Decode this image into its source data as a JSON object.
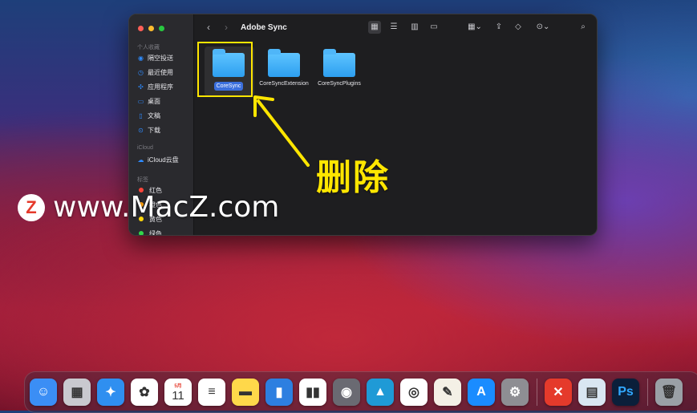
{
  "window": {
    "title": "Adobe Sync",
    "sidebar": {
      "favorites_title": "个人收藏",
      "favorites": [
        {
          "label": "隔空投送",
          "icon": "airdrop-icon"
        },
        {
          "label": "最近使用",
          "icon": "clock-icon"
        },
        {
          "label": "应用程序",
          "icon": "applications-icon"
        },
        {
          "label": "桌面",
          "icon": "desktop-icon"
        },
        {
          "label": "文稿",
          "icon": "document-icon"
        },
        {
          "label": "下载",
          "icon": "download-icon"
        }
      ],
      "icloud_title": "iCloud",
      "icloud": [
        {
          "label": "iCloud云盘",
          "icon": "cloud-icon"
        }
      ],
      "tags_title": "标签",
      "tags": [
        {
          "label": "红色",
          "color": "#ff453a"
        },
        {
          "label": "橙色",
          "color": "#ff9f0a"
        },
        {
          "label": "黄色",
          "color": "#ffd60a"
        },
        {
          "label": "绿色",
          "color": "#32d74b"
        }
      ]
    },
    "files": [
      {
        "name": "CoreSync",
        "selected": true
      },
      {
        "name": "CoreSyncExtension",
        "selected": false
      },
      {
        "name": "CoreSyncPlugins",
        "selected": false
      }
    ]
  },
  "annotation": {
    "label": "删除",
    "color": "#ffe600"
  },
  "watermark": {
    "logo": "Z",
    "text": "www.MacZ.com"
  },
  "dock": {
    "apps": [
      {
        "name": "finder",
        "glyph": "☺",
        "color": "#3b8ef5"
      },
      {
        "name": "launchpad",
        "glyph": "▦",
        "color": "#c9c9cf"
      },
      {
        "name": "safari",
        "glyph": "✦",
        "color": "#2f8ff0"
      },
      {
        "name": "photos",
        "glyph": "✿",
        "color": "#ffffff"
      },
      {
        "name": "calendar",
        "glyph": "11",
        "month": "5月",
        "color": "#ffffff"
      },
      {
        "name": "reminders",
        "glyph": "≡",
        "color": "#ffffff"
      },
      {
        "name": "notes",
        "glyph": "▬",
        "color": "#ffd84a"
      },
      {
        "name": "keynote",
        "glyph": "▮",
        "color": "#2d7fe0"
      },
      {
        "name": "numbers",
        "glyph": "▮▮",
        "color": "#ffffff"
      },
      {
        "name": "gamecenter",
        "glyph": "◉",
        "color": "#6a6a72"
      },
      {
        "name": "altstore",
        "glyph": "▲",
        "color": "#1f9ad6"
      },
      {
        "name": "chrome",
        "glyph": "◎",
        "color": "#ffffff"
      },
      {
        "name": "textedit",
        "glyph": "✎",
        "color": "#f4f0e6"
      },
      {
        "name": "appstore",
        "glyph": "A",
        "color": "#1a8cff"
      },
      {
        "name": "settings",
        "glyph": "⚙",
        "color": "#8e8e93"
      },
      {
        "name": "xmind",
        "glyph": "✕",
        "color": "#e53a2b"
      },
      {
        "name": "preview",
        "glyph": "▤",
        "color": "#d9e6f2"
      },
      {
        "name": "photoshop",
        "glyph": "Ps",
        "color": "#0b1f3a"
      },
      {
        "name": "trash",
        "glyph": "🗑",
        "color": "#9aa0a6"
      }
    ]
  }
}
